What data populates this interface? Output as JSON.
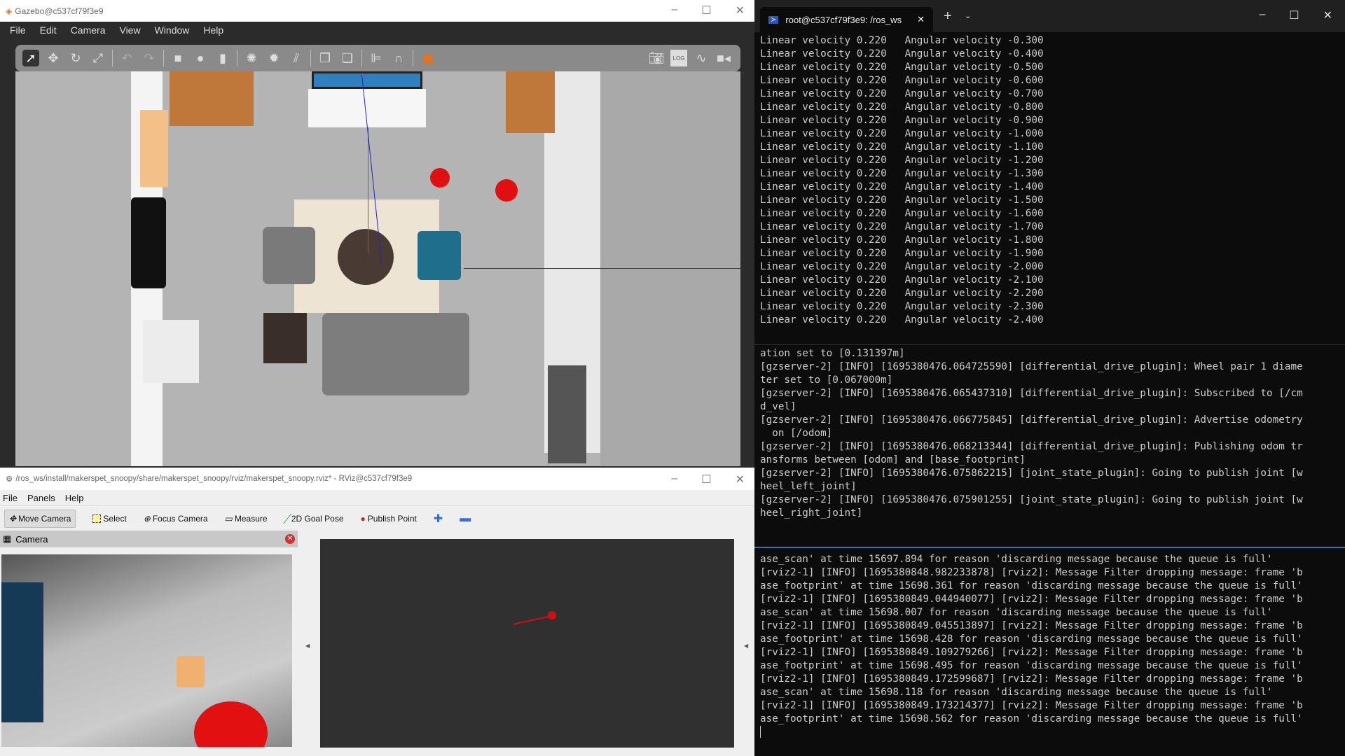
{
  "gazebo": {
    "title": "Gazebo@c537cf79f3e9",
    "menu": [
      "File",
      "Edit",
      "Camera",
      "View",
      "Window",
      "Help"
    ],
    "log_icon_label": "LOG"
  },
  "rviz": {
    "title": "/ros_ws/install/makerspet_snoopy/share/makerspet_snoopy/rviz/makerspet_snoopy.rviz* - RViz@c537cf79f3e9",
    "menu": [
      "File",
      "Panels",
      "Help"
    ],
    "tools": [
      "Move Camera",
      "Select",
      "Focus Camera",
      "Measure",
      "2D Goal Pose",
      "Publish Point"
    ],
    "camera_panel": "Camera"
  },
  "terminal": {
    "tab": "root@c537cf79f3e9: /ros_ws",
    "pane1": [
      "Linear velocity 0.220   Angular velocity -0.300",
      "Linear velocity 0.220   Angular velocity -0.400",
      "Linear velocity 0.220   Angular velocity -0.500",
      "Linear velocity 0.220   Angular velocity -0.600",
      "Linear velocity 0.220   Angular velocity -0.700",
      "Linear velocity 0.220   Angular velocity -0.800",
      "Linear velocity 0.220   Angular velocity -0.900",
      "Linear velocity 0.220   Angular velocity -1.000",
      "Linear velocity 0.220   Angular velocity -1.100",
      "Linear velocity 0.220   Angular velocity -1.200",
      "Linear velocity 0.220   Angular velocity -1.300",
      "Linear velocity 0.220   Angular velocity -1.400",
      "Linear velocity 0.220   Angular velocity -1.500",
      "Linear velocity 0.220   Angular velocity -1.600",
      "Linear velocity 0.220   Angular velocity -1.700",
      "Linear velocity 0.220   Angular velocity -1.800",
      "Linear velocity 0.220   Angular velocity -1.900",
      "Linear velocity 0.220   Angular velocity -2.000",
      "Linear velocity 0.220   Angular velocity -2.100",
      "Linear velocity 0.220   Angular velocity -2.200",
      "Linear velocity 0.220   Angular velocity -2.300",
      "Linear velocity 0.220   Angular velocity -2.400"
    ],
    "pane2": [
      "ation set to [0.131397m]",
      "[gzserver-2] [INFO] [1695380476.064725590] [differential_drive_plugin]: Wheel pair 1 diame",
      "ter set to [0.067000m]",
      "[gzserver-2] [INFO] [1695380476.065437310] [differential_drive_plugin]: Subscribed to [/cm",
      "d_vel]",
      "[gzserver-2] [INFO] [1695380476.066775845] [differential_drive_plugin]: Advertise odometry",
      "  on [/odom]",
      "[gzserver-2] [INFO] [1695380476.068213344] [differential_drive_plugin]: Publishing odom tr",
      "ansforms between [odom] and [base_footprint]",
      "[gzserver-2] [INFO] [1695380476.075862215] [joint_state_plugin]: Going to publish joint [w",
      "heel_left_joint]",
      "[gzserver-2] [INFO] [1695380476.075901255] [joint_state_plugin]: Going to publish joint [w",
      "heel_right_joint]"
    ],
    "pane3": [
      "ase_scan' at time 15697.894 for reason 'discarding message because the queue is full'",
      "[rviz2-1] [INFO] [1695380848.982233878] [rviz2]: Message Filter dropping message: frame 'b",
      "ase_footprint' at time 15698.361 for reason 'discarding message because the queue is full'",
      "[rviz2-1] [INFO] [1695380849.044940077] [rviz2]: Message Filter dropping message: frame 'b",
      "ase_scan' at time 15698.007 for reason 'discarding message because the queue is full'",
      "[rviz2-1] [INFO] [1695380849.045513897] [rviz2]: Message Filter dropping message: frame 'b",
      "ase_footprint' at time 15698.428 for reason 'discarding message because the queue is full'",
      "[rviz2-1] [INFO] [1695380849.109279266] [rviz2]: Message Filter dropping message: frame 'b",
      "ase_footprint' at time 15698.495 for reason 'discarding message because the queue is full'",
      "[rviz2-1] [INFO] [1695380849.172599687] [rviz2]: Message Filter dropping message: frame 'b",
      "ase_scan' at time 15698.118 for reason 'discarding message because the queue is full'",
      "[rviz2-1] [INFO] [1695380849.173214377] [rviz2]: Message Filter dropping message: frame 'b",
      "ase_footprint' at time 15698.562 for reason 'discarding message because the queue is full'"
    ]
  }
}
